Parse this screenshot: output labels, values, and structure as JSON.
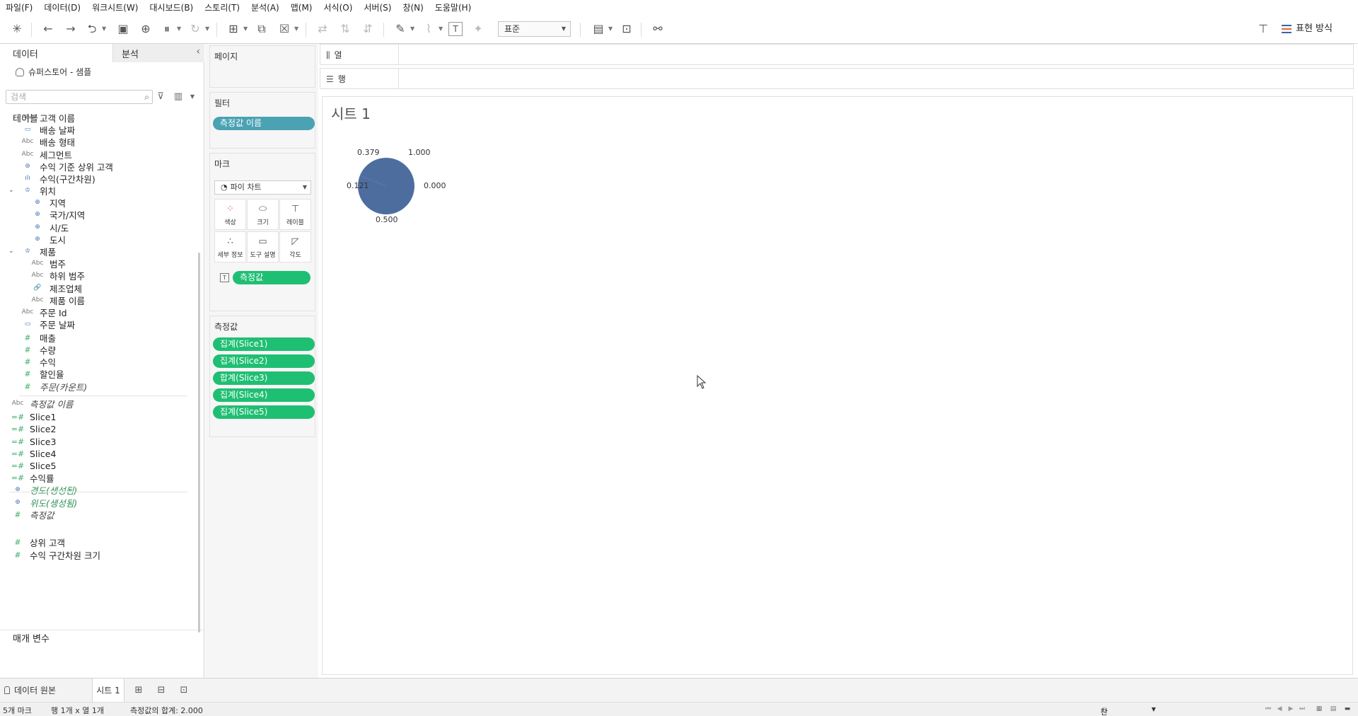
{
  "menu": [
    "파일(F)",
    "데이터(D)",
    "워크시트(W)",
    "대시보드(B)",
    "스토리(T)",
    "분석(A)",
    "맵(M)",
    "서식(O)",
    "서버(S)",
    "창(N)",
    "도움말(H)"
  ],
  "toolbar": {
    "fit_value": "표준",
    "show_me_label": "표현 방식",
    "icons": [
      "tableau-logo-icon",
      "undo-icon",
      "redo-icon",
      "replay-icon",
      "save-icon",
      "new-datasource-icon",
      "pause-updates-icon",
      "refresh-icon",
      "new-worksheet-icon",
      "duplicate-sheet-icon",
      "clear-sheet-icon",
      "swap-icon",
      "sort-ascending-icon",
      "sort-descending-icon",
      "highlight-icon",
      "group-icon",
      "show-labels-icon",
      "pin-axes-icon",
      "show-cards-icon",
      "presentation-icon",
      "share-icon",
      "tooltip-icon"
    ]
  },
  "data_pane": {
    "tab_data": "데이터",
    "tab_analysis": "분석",
    "datasource": "슈퍼스토어 - 샘플",
    "search_placeholder": "검색",
    "tables_title": "테이블",
    "params_title": "매개 변수",
    "fields": [
      {
        "type": "Abc",
        "name": "고객 이름"
      },
      {
        "type": "date",
        "name": "배송 날짜"
      },
      {
        "type": "Abc",
        "name": "배송 형태"
      },
      {
        "type": "Abc",
        "name": "세그먼트"
      },
      {
        "type": "set",
        "name": "수익 기준 상위 고객"
      },
      {
        "type": "bin",
        "name": "수익(구간차원)"
      },
      {
        "type": "hier",
        "name": "위치"
      },
      {
        "type": "geo",
        "name": "지역"
      },
      {
        "type": "geo",
        "name": "국가/지역"
      },
      {
        "type": "geo",
        "name": "시/도"
      },
      {
        "type": "geo",
        "name": "도시"
      },
      {
        "type": "hier",
        "name": "제품"
      },
      {
        "type": "Abc",
        "name": "범주"
      },
      {
        "type": "Abc",
        "name": "하위 범주"
      },
      {
        "type": "calc",
        "name": "제조업체"
      },
      {
        "type": "Abc",
        "name": "제품 이름"
      },
      {
        "type": "Abc",
        "name": "주문 Id"
      },
      {
        "type": "date",
        "name": "주문 날짜"
      },
      {
        "type": "#",
        "name": "매출"
      },
      {
        "type": "#",
        "name": "수량"
      },
      {
        "type": "#",
        "name": "수익"
      },
      {
        "type": "#",
        "name": "할인율"
      },
      {
        "type": "#",
        "name": "주문(카운트)"
      },
      {
        "type": "Abc",
        "name": "측정값 이름"
      },
      {
        "type": "=#",
        "name": "Slice1"
      },
      {
        "type": "=#",
        "name": "Slice2"
      },
      {
        "type": "=#",
        "name": "Slice3"
      },
      {
        "type": "=#",
        "name": "Slice4"
      },
      {
        "type": "=#",
        "name": "Slice5"
      },
      {
        "type": "=#",
        "name": "수익률"
      },
      {
        "type": "geo",
        "name": "경도(생성됨)"
      },
      {
        "type": "geo",
        "name": "위도(생성됨)"
      },
      {
        "type": "#",
        "name": "측정값"
      }
    ],
    "params": [
      {
        "type": "#",
        "name": "상위 고객"
      },
      {
        "type": "#",
        "name": "수익 구간차원 크기"
      }
    ]
  },
  "shelves": {
    "pages_title": "페이지",
    "filters_title": "필터",
    "filter_pill": "측정값 이름",
    "marks_title": "마크",
    "mark_type": "파이 차트",
    "mark_buttons": [
      "색상",
      "크기",
      "레이블",
      "세부 정보",
      "도구 설명",
      "각도"
    ],
    "label_pill": "측정값",
    "measures_title": "측정값",
    "measure_pills": [
      "집계(Slice1)",
      "집계(Slice2)",
      "합계(Slice3)",
      "집계(Slice4)",
      "집계(Slice5)"
    ],
    "columns_label": "열",
    "rows_label": "행"
  },
  "sheet": {
    "title": "시트 1"
  },
  "chart_data": {
    "type": "pie",
    "labels": [
      "1.000",
      "0.000",
      "0.500",
      "0.121",
      "0.379"
    ],
    "values": [
      1.0,
      0.0,
      0.5,
      0.121,
      0.379
    ],
    "color": "#4e6d9f"
  },
  "bottom": {
    "source_tab": "데이터 원본",
    "sheet_tab": "시트 1",
    "status_marks": "5개 마크",
    "status_rows_cols": "행 1개 x 열 1개",
    "status_sum": "측정값의 합계: 2.000",
    "user": "찬양 김"
  }
}
